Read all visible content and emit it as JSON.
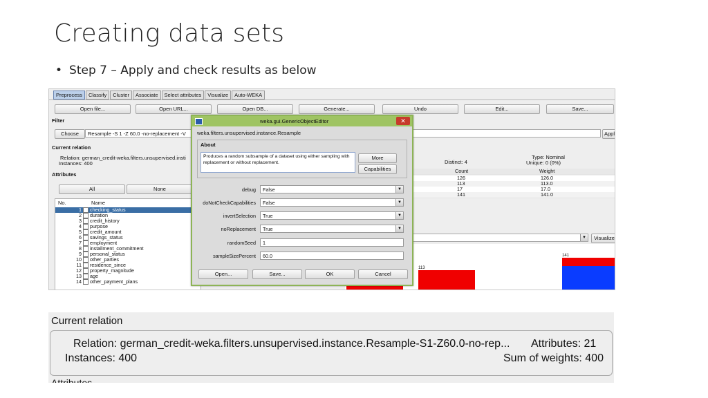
{
  "slide": {
    "title": "Creating data sets",
    "bullet": "Step 7 – Apply and check results as below"
  },
  "weka": {
    "tabs": [
      "Preprocess",
      "Classify",
      "Cluster",
      "Associate",
      "Select attributes",
      "Visualize",
      "Auto-WEKA"
    ],
    "buttons": {
      "open_file": "Open file...",
      "open_url": "Open URL...",
      "open_db": "Open DB...",
      "generate": "Generate...",
      "undo": "Undo",
      "edit": "Edit...",
      "save": "Save..."
    },
    "filter": {
      "label": "Filter",
      "choose": "Choose",
      "value": "Resample -S 1 -Z 60.0 -no-replacement -V",
      "apply": "Apply"
    },
    "current_relation": {
      "label": "Current relation",
      "relation": "Relation:  german_credit-weka.filters.unsupervised.insti",
      "instances": "Instances:  400"
    },
    "attributes": {
      "label": "Attributes",
      "all": "All",
      "none": "None",
      "col_no": "No.",
      "col_name": "Name",
      "items": [
        {
          "no": "1",
          "name": "checking_status"
        },
        {
          "no": "2",
          "name": "duration"
        },
        {
          "no": "3",
          "name": "credit_history"
        },
        {
          "no": "4",
          "name": "purpose"
        },
        {
          "no": "5",
          "name": "credit_amount"
        },
        {
          "no": "6",
          "name": "savings_status"
        },
        {
          "no": "7",
          "name": "employment"
        },
        {
          "no": "8",
          "name": "installment_commitment"
        },
        {
          "no": "9",
          "name": "personal_status"
        },
        {
          "no": "10",
          "name": "other_parties"
        },
        {
          "no": "11",
          "name": "residence_since"
        },
        {
          "no": "12",
          "name": "property_magnitude"
        },
        {
          "no": "13",
          "name": "age"
        },
        {
          "no": "14",
          "name": "other_payment_plans"
        }
      ]
    },
    "selected_attr": {
      "distinct": "Distinct: 4",
      "type": "Type: Nominal",
      "unique": "Unique: 0 (0%)",
      "col_count": "Count",
      "col_weight": "Weight",
      "rows": [
        {
          "count": "126",
          "weight": "126.0"
        },
        {
          "count": "113",
          "weight": "113.0"
        },
        {
          "count": "17",
          "weight": "17.0"
        },
        {
          "count": "141",
          "weight": "141.0"
        }
      ]
    },
    "visualize": "Visualize",
    "bar_labels": {
      "b113": "113",
      "b141": "141"
    }
  },
  "dialog": {
    "title": "weka.gui.GenericObjectEditor",
    "class": "weka.filters.unsupervised.instance.Resample",
    "about_label": "About",
    "about_text": "Produces a random subsample of a dataset using either sampling with replacement or without replacement.",
    "more": "More",
    "capabilities": "Capabilities",
    "props": [
      {
        "label": "debug",
        "value": "False",
        "dropdown": true
      },
      {
        "label": "doNotCheckCapabilities",
        "value": "False",
        "dropdown": true
      },
      {
        "label": "invertSelection",
        "value": "True",
        "dropdown": true
      },
      {
        "label": "noReplacement",
        "value": "True",
        "dropdown": true
      },
      {
        "label": "randomSeed",
        "value": "1",
        "dropdown": false
      },
      {
        "label": "sampleSizePercent",
        "value": "60.0",
        "dropdown": false
      }
    ],
    "buttons": {
      "open": "Open...",
      "save": "Save...",
      "ok": "OK",
      "cancel": "Cancel"
    }
  },
  "zoom": {
    "title": "Current relation",
    "relation": "Relation:  german_credit-weka.filters.unsupervised.instance.Resample-S1-Z60.0-no-rep...",
    "instances": "Instances:  400",
    "attributes": "Attributes:  21",
    "sum_weights": "Sum of weights:  400",
    "cut_off": "Attributes"
  }
}
